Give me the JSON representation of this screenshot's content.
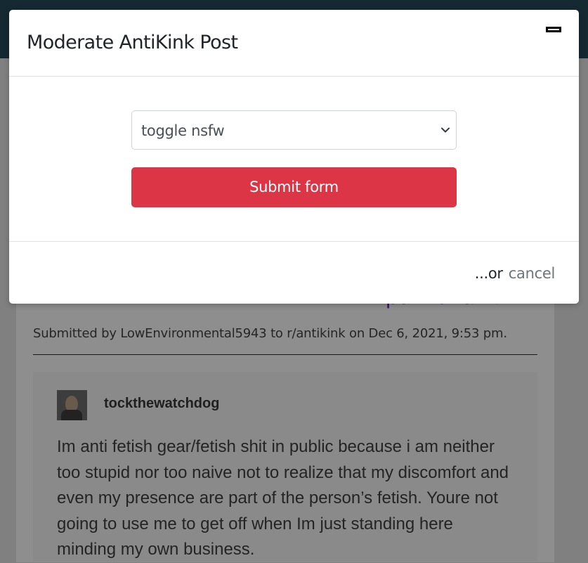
{
  "modal": {
    "title": "Moderate AntiKink Post",
    "select": {
      "selected": "toggle nsfw"
    },
    "submit_label": "Submit form",
    "footer": {
      "or_text": "...or",
      "cancel_label": "cancel"
    }
  },
  "background_page": {
    "post_title_fragment": "part of a kink?",
    "submitted_line": "Submitted by LowEnvironmental5943 to r/antikink on Dec 6, 2021, 9:53 pm.",
    "embed": {
      "username": "tockthewatchdog",
      "text": "Im anti fetish gear/fetish shit in public because i am neither too stupid nor too naive not to realize that my discomfort and even my presence are part of the person’s fetish. Youre not going to use me to get off when Im just standing here minding my own business."
    }
  },
  "colors": {
    "topbar": "#152932",
    "danger": "#dc3545",
    "overlay": "#808080",
    "muted": "#6c757d"
  },
  "icons": [
    "close-icon",
    "chevron-down-icon"
  ]
}
